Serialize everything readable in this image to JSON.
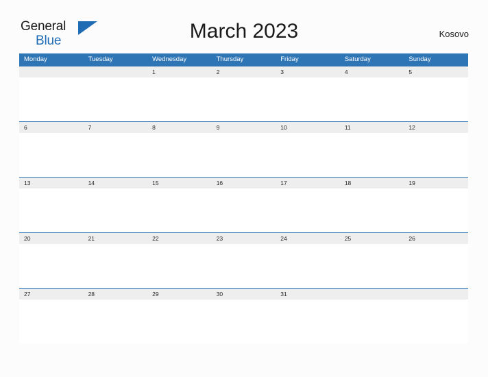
{
  "brand": {
    "name_part1": "General",
    "name_part2": "Blue",
    "flag_icon": "blue-flag-triangle",
    "color_dark": "#1a1a1a",
    "color_blue": "#1f6cb4"
  },
  "header": {
    "title": "March 2023",
    "country": "Kosovo"
  },
  "calendar": {
    "header_bg": "#2e75b6",
    "band_bg": "#eeeeee",
    "cell_bg": "#ffffff",
    "weekdays": [
      "Monday",
      "Tuesday",
      "Wednesday",
      "Thursday",
      "Friday",
      "Saturday",
      "Sunday"
    ],
    "weeks": [
      [
        "",
        "",
        "1",
        "2",
        "3",
        "4",
        "5"
      ],
      [
        "6",
        "7",
        "8",
        "9",
        "10",
        "11",
        "12"
      ],
      [
        "13",
        "14",
        "15",
        "16",
        "17",
        "18",
        "19"
      ],
      [
        "20",
        "21",
        "22",
        "23",
        "24",
        "25",
        "26"
      ],
      [
        "27",
        "28",
        "29",
        "30",
        "31",
        "",
        ""
      ]
    ]
  }
}
